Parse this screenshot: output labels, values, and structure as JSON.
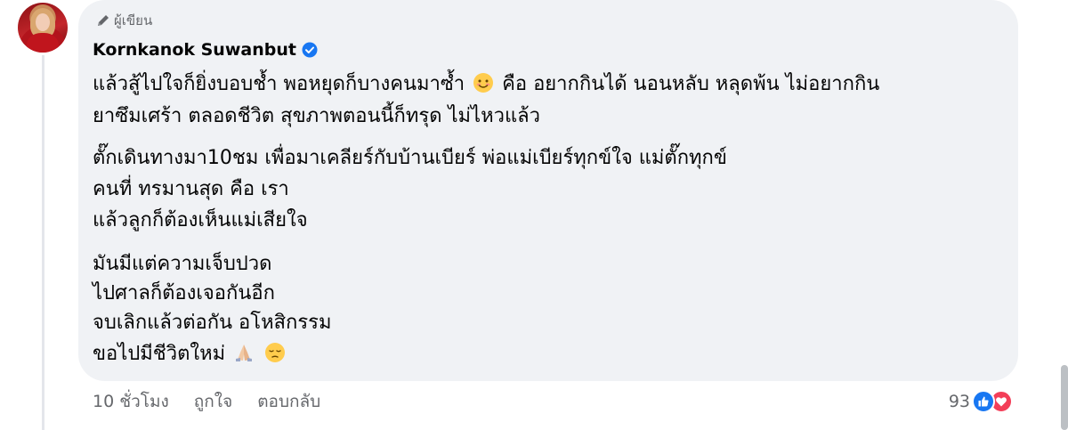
{
  "comment": {
    "author_badge_label": "ผู้เขียน",
    "author_name": "Kornkanok Suwanbut",
    "paragraph1": {
      "line1_before_emoji": "แล้วสู้ไปใจก็ยิ่งบอบช้ำ พอหยุดก็บางคนมาซ้ำ",
      "line1_after_emoji": "คือ อยากกินได้ นอนหลับ หลุดพ้น ไม่อยากกิน",
      "line2": "ยาซึมเศร้า ตลอดชีวิต สุขภาพตอนนี้ก็ทรุด ไม่ไหวแล้ว"
    },
    "paragraph2": {
      "line1": "ตั๊กเดินทางมา10ชม เพื่อมาเคลียร์กับบ้านเบียร์ พ่อแม่เบียร์ทุกข์ใจ แม่ตั๊กทุกข์",
      "line2": "คนที่ ทรมานสุด คือ เรา",
      "line3": "แล้วลูกก็ต้องเห็นแม่เสียใจ"
    },
    "paragraph3": {
      "line1": "มันมีแต่ความเจ็บปวด",
      "line2": "ไปศาลก็ต้องเจอกันอีก",
      "line3": "จบเลิกแล้วต่อกัน อโหสิกรรม",
      "line4": "ขอไปมีชีวิตใหม่"
    },
    "emojis": [
      "smiling-face-emoji",
      "folded-hands-emoji",
      "pensive-face-emoji"
    ],
    "icons": {
      "author_badge": "pencil-icon",
      "verified": "verified-badge-icon",
      "reaction_like": "like-icon",
      "reaction_love": "love-icon"
    }
  },
  "actions": {
    "timestamp": "10 ชั่วโมง",
    "like_label": "ถูกใจ",
    "reply_label": "ตอบกลับ"
  },
  "reactions": {
    "count": "93"
  },
  "colors": {
    "bubble_bg": "#f0f2f5",
    "secondary_text": "#65676b",
    "verified_blue": "#1877f2",
    "love_red": "#f33e58"
  }
}
